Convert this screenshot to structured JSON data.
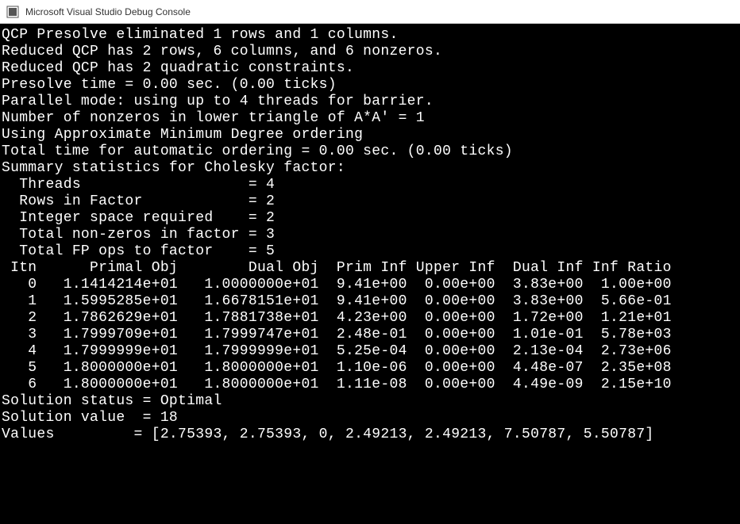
{
  "window": {
    "title": "Microsoft Visual Studio Debug Console"
  },
  "console": {
    "lines_pre": [
      "QCP Presolve eliminated 1 rows and 1 columns.",
      "Reduced QCP has 2 rows, 6 columns, and 6 nonzeros.",
      "Reduced QCP has 2 quadratic constraints.",
      "Presolve time = 0.00 sec. (0.00 ticks)",
      "Parallel mode: using up to 4 threads for barrier.",
      "Number of nonzeros in lower triangle of A*A' = 1",
      "Using Approximate Minimum Degree ordering",
      "Total time for automatic ordering = 0.00 sec. (0.00 ticks)",
      "Summary statistics for Cholesky factor:",
      "  Threads                   = 4",
      "  Rows in Factor            = 2",
      "  Integer space required    = 2",
      "  Total non-zeros in factor = 3",
      "  Total FP ops to factor    = 5"
    ],
    "table_header": " Itn      Primal Obj        Dual Obj  Prim Inf Upper Inf  Dual Inf Inf Ratio",
    "table_rows": [
      "   0   1.1414214e+01   1.0000000e+01  9.41e+00  0.00e+00  3.83e+00  1.00e+00",
      "   1   1.5995285e+01   1.6678151e+01  9.41e+00  0.00e+00  3.83e+00  5.66e-01",
      "   2   1.7862629e+01   1.7881738e+01  4.23e+00  0.00e+00  1.72e+00  1.21e+01",
      "   3   1.7999709e+01   1.7999747e+01  2.48e-01  0.00e+00  1.01e-01  5.78e+03",
      "   4   1.7999999e+01   1.7999999e+01  5.25e-04  0.00e+00  2.13e-04  2.73e+06",
      "   5   1.8000000e+01   1.8000000e+01  1.10e-06  0.00e+00  4.48e-07  2.35e+08",
      "   6   1.8000000e+01   1.8000000e+01  1.11e-08  0.00e+00  4.49e-09  2.15e+10"
    ],
    "lines_post": [
      "Solution status = Optimal",
      "Solution value  = 18",
      "Values         = [2.75393, 2.75393, 0, 2.49213, 2.49213, 7.50787, 5.50787]"
    ]
  },
  "chart_data": {
    "type": "table",
    "title": "Barrier Iteration Log",
    "columns": [
      "Itn",
      "Primal Obj",
      "Dual Obj",
      "Prim Inf",
      "Upper Inf",
      "Dual Inf",
      "Inf Ratio"
    ],
    "rows": [
      [
        0,
        11.414214,
        10.0,
        9.41,
        0.0,
        3.83,
        1.0
      ],
      [
        1,
        15.995285,
        16.678151,
        9.41,
        0.0,
        3.83,
        0.566
      ],
      [
        2,
        17.862629,
        17.881738,
        4.23,
        0.0,
        1.72,
        12.1
      ],
      [
        3,
        17.999709,
        17.999747,
        0.248,
        0.0,
        0.101,
        5780.0
      ],
      [
        4,
        17.999999,
        17.999999,
        0.000525,
        0.0,
        0.000213,
        2730000.0
      ],
      [
        5,
        18.0,
        18.0,
        1.1e-06,
        0.0,
        4.48e-07,
        235000000.0
      ],
      [
        6,
        18.0,
        18.0,
        1.11e-08,
        0.0,
        4.49e-09,
        21500000000.0
      ]
    ],
    "summary": {
      "solution_status": "Optimal",
      "solution_value": 18,
      "values": [
        2.75393,
        2.75393,
        0,
        2.49213,
        2.49213,
        7.50787,
        5.50787
      ]
    }
  }
}
